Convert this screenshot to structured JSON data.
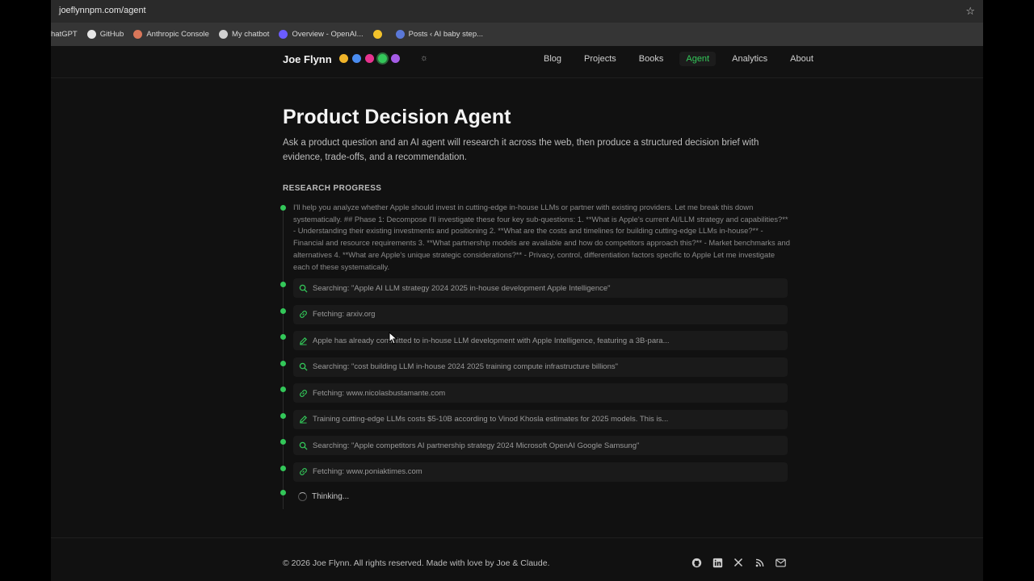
{
  "browser": {
    "url": "joeflynnpm.com/agent",
    "bookmarks": [
      {
        "label": "hatGPT",
        "icon": "chatgpt-icon",
        "color": "#d0d0d0"
      },
      {
        "label": "GitHub",
        "icon": "github-icon",
        "color": "#e6e6e6"
      },
      {
        "label": "Anthropic Console",
        "icon": "anthropic-icon",
        "color": "#d9775a"
      },
      {
        "label": "My chatbot",
        "icon": "chatbot-icon",
        "color": "#d0d0d0"
      },
      {
        "label": "Overview - OpenAI...",
        "icon": "openai-icon",
        "color": "#6b5cff"
      },
      {
        "label": "",
        "icon": "note-icon",
        "color": "#f2c22b"
      },
      {
        "label": "Posts ‹ AI baby step...",
        "icon": "wordpress-icon",
        "color": "#5a78d8"
      }
    ]
  },
  "header": {
    "brand": "Joe Flynn",
    "theme_dots": [
      "#f0b429",
      "#4a8cf0",
      "#e6338f",
      "#33c759",
      "#a55ce6"
    ],
    "active_dot": 3,
    "nav": [
      "Blog",
      "Projects",
      "Books",
      "Agent",
      "Analytics",
      "About"
    ],
    "active_nav": "Agent"
  },
  "main": {
    "title": "Product Decision Agent",
    "subtitle": "Ask a product question and an AI agent will research it across the web, then produce a structured decision brief with evidence, trade-offs, and a recommendation.",
    "section_label": "RESEARCH PROGRESS",
    "intro": "I'll help you analyze whether Apple should invest in cutting-edge in-house LLMs or partner with existing providers. Let me break this down systematically. ## Phase 1: Decompose I'll investigate these four key sub-questions: 1. **What is Apple's current AI/LLM strategy and capabilities?** - Understanding their existing investments and positioning 2. **What are the costs and timelines for building cutting-edge LLMs in-house?** - Financial and resource requirements 3. **What partnership models are available and how do competitors approach this?** - Market benchmarks and alternatives 4. **What are Apple's unique strategic considerations?** - Privacy, control, differentiation factors specific to Apple Let me investigate each of these systematically.",
    "steps": [
      {
        "type": "search",
        "text": "Searching: \"Apple AI LLM strategy 2024 2025 in-house development Apple Intelligence\""
      },
      {
        "type": "fetch",
        "text": "Fetching: arxiv.org"
      },
      {
        "type": "note",
        "text": "Apple has already committed to in-house LLM development with Apple Intelligence, featuring a 3B-para..."
      },
      {
        "type": "search",
        "text": "Searching: \"cost building LLM in-house 2024 2025 training compute infrastructure billions\""
      },
      {
        "type": "fetch",
        "text": "Fetching: www.nicolasbustamante.com"
      },
      {
        "type": "note",
        "text": "Training cutting-edge LLMs costs $5-10B according to Vinod Khosla estimates for 2025 models. This is..."
      },
      {
        "type": "search",
        "text": "Searching: \"Apple competitors AI partnership strategy 2024 Microsoft OpenAI Google Samsung\""
      },
      {
        "type": "fetch",
        "text": "Fetching: www.poniaktimes.com"
      }
    ],
    "thinking": "Thinking..."
  },
  "footer": {
    "copyright": "© 2026 Joe Flynn. All rights reserved. Made with love by Joe & Claude.",
    "socials": [
      "github-icon",
      "linkedin-icon",
      "x-icon",
      "rss-icon",
      "mail-icon"
    ]
  },
  "colors": {
    "accent": "#33c759",
    "background": "#111111"
  }
}
